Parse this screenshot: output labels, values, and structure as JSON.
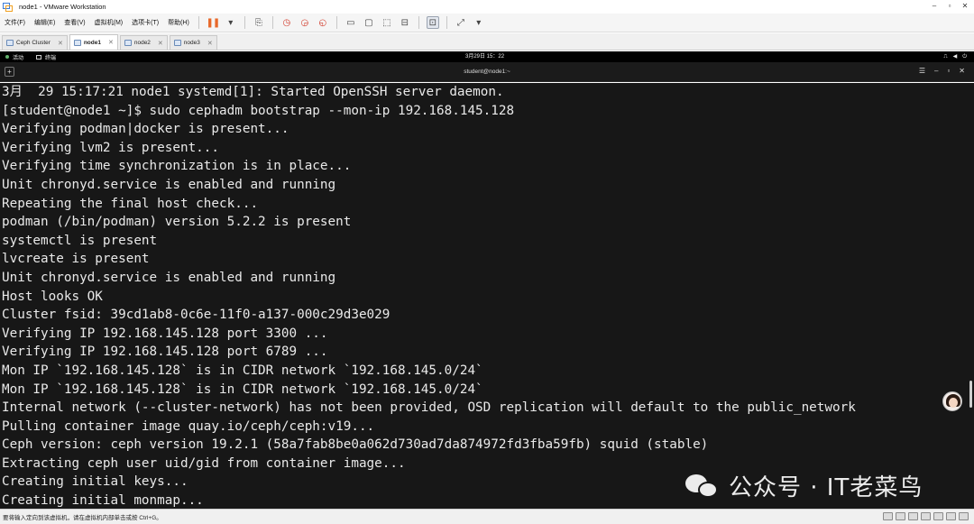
{
  "window": {
    "title": "node1 - VMware Workstation",
    "controls": [
      "–",
      "▫",
      "✕"
    ]
  },
  "menu": {
    "items": [
      "文件(F)",
      "编辑(E)",
      "查看(V)",
      "虚拟机(M)",
      "选项卡(T)",
      "帮助(H)"
    ]
  },
  "tabs": [
    {
      "label": "Ceph Cluster",
      "close": "✕"
    },
    {
      "label": "node1",
      "close": "✕",
      "active": true
    },
    {
      "label": "node2",
      "close": "✕"
    },
    {
      "label": "node3",
      "close": "✕"
    }
  ],
  "guest_topbar": {
    "activities": "活动",
    "app": "终端",
    "clock": "3月29日 15：22"
  },
  "terminal": {
    "title": "student@node1:~",
    "lines": [
      "3月  29 15:17:21 node1 systemd[1]: Started OpenSSH server daemon.",
      "[student@node1 ~]$ sudo cephadm bootstrap --mon-ip 192.168.145.128",
      "Verifying podman|docker is present...",
      "Verifying lvm2 is present...",
      "Verifying time synchronization is in place...",
      "Unit chronyd.service is enabled and running",
      "Repeating the final host check...",
      "podman (/bin/podman) version 5.2.2 is present",
      "systemctl is present",
      "lvcreate is present",
      "Unit chronyd.service is enabled and running",
      "Host looks OK",
      "Cluster fsid: 39cd1ab8-0c6e-11f0-a137-000c29d3e029",
      "Verifying IP 192.168.145.128 port 3300 ...",
      "Verifying IP 192.168.145.128 port 6789 ...",
      "Mon IP `192.168.145.128` is in CIDR network `192.168.145.0/24`",
      "Mon IP `192.168.145.128` is in CIDR network `192.168.145.0/24`",
      "Internal network (--cluster-network) has not been provided, OSD replication will default to the public_network",
      "Pulling container image quay.io/ceph/ceph:v19...",
      "Ceph version: ceph version 19.2.1 (58a7fab8be0a062d730ad7da874972fd3fba59fb) squid (stable)",
      "Extracting ceph user uid/gid from container image...",
      "Creating initial keys...",
      "Creating initial monmap..."
    ]
  },
  "watermark": {
    "text": "公众号 · IT老菜鸟"
  },
  "statusbar": {
    "text": "要将输入定向到该虚拟机，请在虚拟机内部单击或按 Ctrl+G。"
  },
  "colors": {
    "terminal_bg": "#171717",
    "terminal_fg": "#e9e9e9",
    "pause_accent": "#e8692b"
  }
}
